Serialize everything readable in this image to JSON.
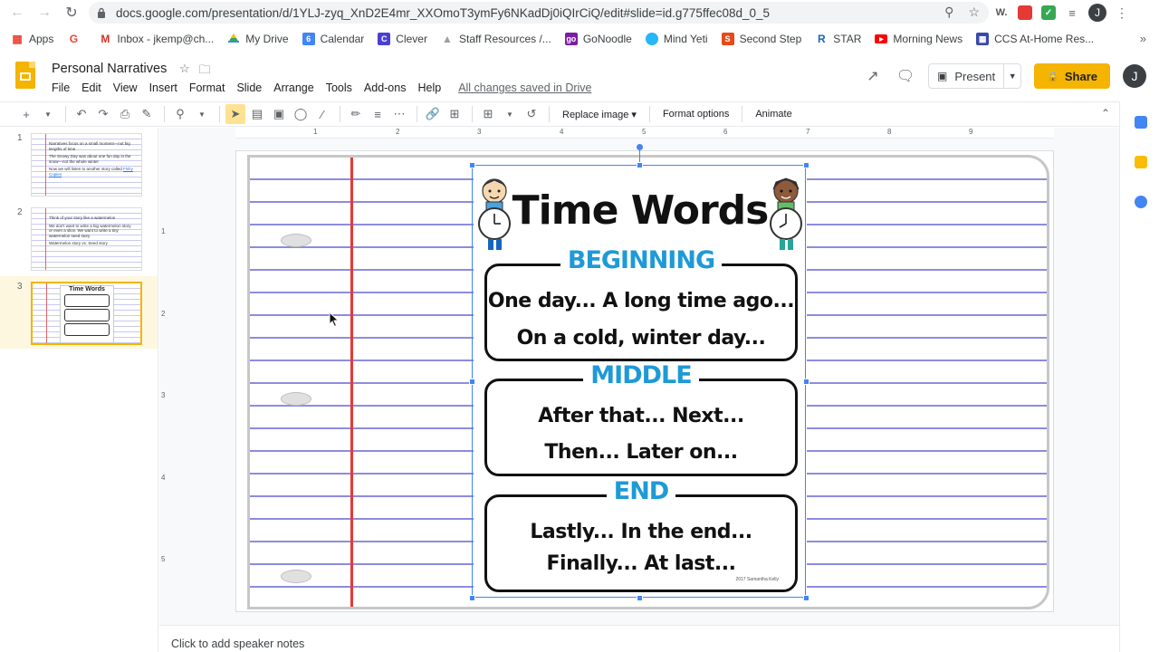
{
  "browser": {
    "url": "docs.google.com/presentation/d/1YLJ-zyq_XnD2E4mr_XXOmoT3ymFy6NKadDj0iQIrCiQ/edit#slide=id.g775ffec08d_0_5",
    "profile_initial": "J"
  },
  "bookmarks": [
    {
      "label": "Apps",
      "icon": "apps-grid-icon",
      "color": "#ea4335"
    },
    {
      "label": "",
      "icon": "google-icon",
      "color": "#ea4335"
    },
    {
      "label": "Inbox - jkemp@ch...",
      "icon": "gmail-icon",
      "color": "#d93025"
    },
    {
      "label": "My Drive",
      "icon": "drive-icon",
      "color": "#34a853"
    },
    {
      "label": "Calendar",
      "icon": "calendar-icon",
      "color": "#4285f4"
    },
    {
      "label": "Clever",
      "icon": "clever-icon",
      "color": "#4a3fd4"
    },
    {
      "label": "Staff Resources /...",
      "icon": "staff-icon",
      "color": "#9e9e9e"
    },
    {
      "label": "GoNoodle",
      "icon": "gonoodle-icon",
      "color": "#7b1fa2"
    },
    {
      "label": "Mind Yeti",
      "icon": "mindyeti-icon",
      "color": "#29b6f6"
    },
    {
      "label": "Second Step",
      "icon": "secondstep-icon",
      "color": "#e64a19"
    },
    {
      "label": "STAR",
      "icon": "star-renaissance-icon",
      "color": "#1565c0"
    },
    {
      "label": "Morning News",
      "icon": "youtube-icon",
      "color": "#ff0000"
    },
    {
      "label": "CCS At-Home Res...",
      "icon": "ccs-icon",
      "color": "#3949ab"
    }
  ],
  "app": {
    "doc_title": "Personal Narratives",
    "menu": [
      "File",
      "Edit",
      "View",
      "Insert",
      "Format",
      "Slide",
      "Arrange",
      "Tools",
      "Add-ons",
      "Help"
    ],
    "save_status": "All changes saved in Drive",
    "present_label": "Present",
    "share_label": "Share",
    "avatar_initial": "J"
  },
  "toolbar": {
    "replace_image": "Replace image",
    "format_options": "Format options",
    "animate": "Animate"
  },
  "filmstrip": [
    {
      "number": "1",
      "lines": [
        "Narratives focus on a small moment—not big lengths of time",
        "The Snowy Day was about one fun day in the snow—not the whole winter",
        "Now we will listen to another story called"
      ],
      "link": "Fishy Copies"
    },
    {
      "number": "2",
      "lines": [
        "Think of your story like a watermelon",
        "We don't want to write a big watermelon story or even a slice. We want to write a tiny watermelon seed story",
        "Watermelon story vs. Seed story"
      ],
      "link": ""
    },
    {
      "number": "3",
      "lines": [],
      "link": ""
    }
  ],
  "ruler": {
    "h_labels": [
      "1",
      "2",
      "3",
      "4",
      "5",
      "6",
      "7",
      "8",
      "9"
    ],
    "v_labels": [
      "1",
      "2",
      "3",
      "4",
      "5"
    ]
  },
  "poster": {
    "title": "Time Words",
    "sections": [
      {
        "heading": "BEGINNING",
        "lines": [
          "One day...  A long time ago...",
          "On a cold, winter day..."
        ]
      },
      {
        "heading": "MIDDLE",
        "lines": [
          "After that...    Next...",
          "Then...    Later on..."
        ]
      },
      {
        "heading": "END",
        "lines": [
          "Lastly...    In the end...",
          "Finally...    At last..."
        ]
      }
    ],
    "credit": "2017 Samantha Kelly",
    "heading_color": "#1e9ad6"
  },
  "notes": {
    "placeholder": "Click to add speaker notes"
  }
}
